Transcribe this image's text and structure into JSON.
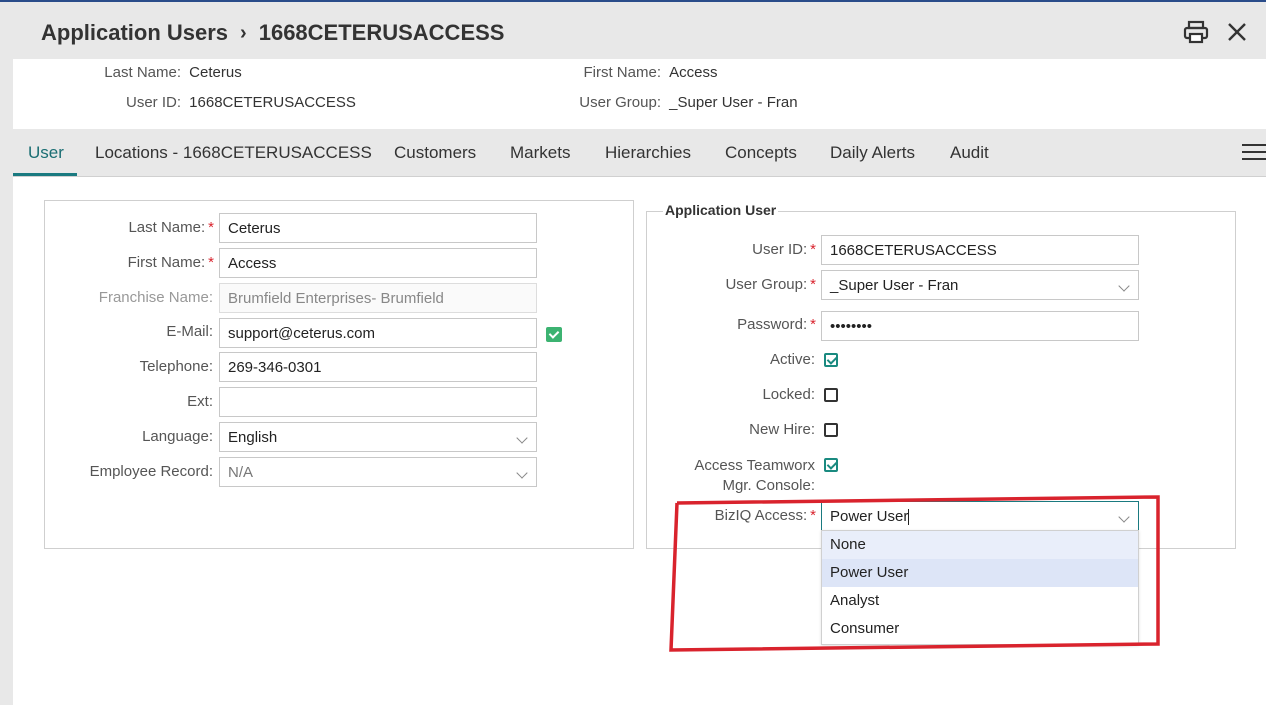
{
  "header": {
    "breadcrumb_root": "Application Users",
    "breadcrumb_sep": "›",
    "breadcrumb_current": "1668CETERUSACCESS"
  },
  "summary": {
    "last_name_label": "Last Name:",
    "last_name": "Ceterus",
    "first_name_label": "First Name:",
    "first_name": "Access",
    "user_id_label": "User ID:",
    "user_id": "1668CETERUSACCESS",
    "user_group_label": "User Group:",
    "user_group": "_Super User - Fran"
  },
  "tabs": [
    {
      "label": "User"
    },
    {
      "label": "Locations - 1668CETERUSACCESS"
    },
    {
      "label": "Customers"
    },
    {
      "label": "Markets"
    },
    {
      "label": "Hierarchies"
    },
    {
      "label": "Concepts"
    },
    {
      "label": "Daily Alerts"
    },
    {
      "label": "Audit"
    }
  ],
  "left_form": {
    "last_name_label": "Last Name:",
    "last_name": "Ceterus",
    "first_name_label": "First Name:",
    "first_name": "Access",
    "franchise_label": "Franchise Name:",
    "franchise": "Brumfield Enterprises- Brumfield",
    "email_label": "E-Mail:",
    "email": "support@ceterus.com",
    "phone_label": "Telephone:",
    "phone": "269-346-0301",
    "ext_label": "Ext:",
    "ext": "",
    "language_label": "Language:",
    "language": "English",
    "employee_label": "Employee Record:",
    "employee": "N/A"
  },
  "app_user": {
    "legend": "Application User",
    "user_id_label": "User ID:",
    "user_id": "1668CETERUSACCESS",
    "user_group_label": "User Group:",
    "user_group": "_Super User - Fran",
    "password_label": "Password:",
    "password": "••••••••",
    "active_label": "Active:",
    "active": true,
    "locked_label": "Locked:",
    "locked": false,
    "new_hire_label": "New Hire:",
    "new_hire": false,
    "teamworx_label_1": "Access Teamworx",
    "teamworx_label_2": "Mgr. Console:",
    "teamworx": true,
    "bizio_label": "BizIQ Access:",
    "bizio_value": "Power User",
    "bizio_options": [
      "None",
      "Power User",
      "Analyst",
      "Consumer"
    ]
  },
  "required_mark": "*",
  "colors": {
    "accent": "#1a7a80",
    "required": "#d9232d",
    "highlight_box": "#d9232d"
  }
}
